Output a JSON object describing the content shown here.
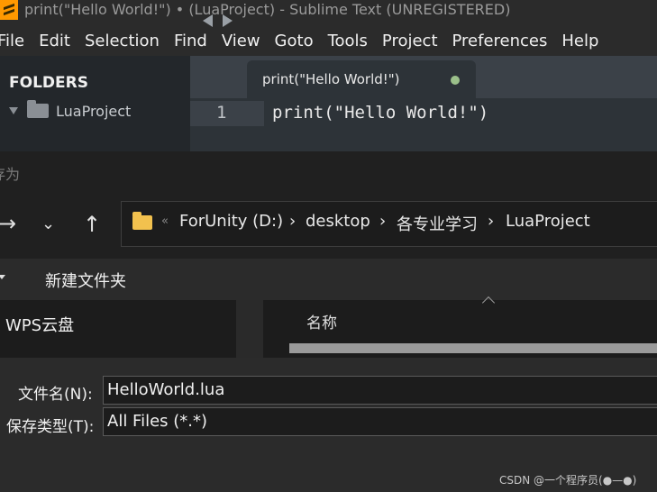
{
  "window": {
    "title": "print(\"Hello World!\") • (LuaProject) - Sublime Text (UNREGISTERED)"
  },
  "menu": [
    "File",
    "Edit",
    "Selection",
    "Find",
    "View",
    "Goto",
    "Tools",
    "Project",
    "Preferences",
    "Help"
  ],
  "sidebar": {
    "header": "FOLDERS",
    "project": "LuaProject"
  },
  "editor": {
    "tab_label": "print(\"Hello World!\")",
    "line_number": "1",
    "code": "print(\"Hello World!\")"
  },
  "dialog": {
    "title": "存为",
    "path": {
      "chevron": "«",
      "crumbs": [
        "ForUnity (D:)",
        "desktop",
        "各专业学习",
        "LuaProject"
      ],
      "separator": "›"
    },
    "new_folder": "新建文件夹",
    "nav_item": "WPS云盘",
    "column_name": "名称",
    "filename_label": "文件名(N):",
    "filename_value": "HelloWorld.lua",
    "filetype_label": "保存类型(T):",
    "filetype_value": "All Files (*.*)"
  },
  "watermark": "CSDN @一个程序员(●—●)",
  "icons": {
    "app": "sublime-logo-icon",
    "folder": "folder-icon",
    "back": "arrow-right-icon",
    "recent": "chevron-down-icon",
    "up": "arrow-up-icon"
  },
  "colors": {
    "modified_dot": "#9bc08a",
    "folder_yellow": "#f2c14e",
    "logo_orange": "#ff9800"
  }
}
